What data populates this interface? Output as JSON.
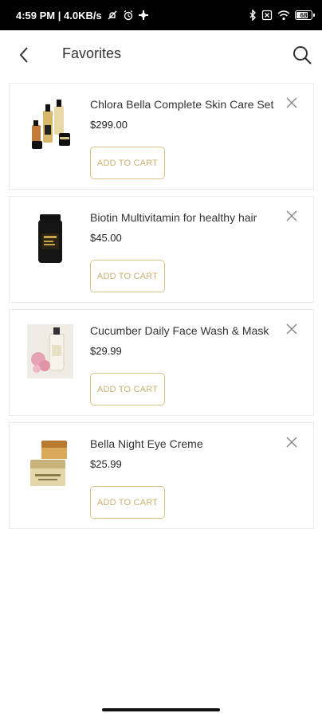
{
  "status_bar": {
    "time_speed": "4:59 PM | 4.0KB/s",
    "battery_level": "68"
  },
  "header": {
    "title": "Favorites",
    "back_icon": "chevron-left-icon",
    "search_icon": "search-icon"
  },
  "colors": {
    "accent_gold": "#c9b172",
    "border": "#ececec"
  },
  "favorites": [
    {
      "name": "Chlora Bella Complete Skin Care Set",
      "price": "$299.00",
      "add_label": "ADD TO CART",
      "image": "skincare-set-bottles"
    },
    {
      "name": "Biotin Multivitamin for healthy hair",
      "price": "$45.00",
      "add_label": "ADD TO CART",
      "image": "vitamin-bottle"
    },
    {
      "name": "Cucumber Daily Face Wash & Mask",
      "price": "$29.99",
      "add_label": "ADD TO CART",
      "image": "face-wash-bottle"
    },
    {
      "name": "Bella Night Eye Creme",
      "price": "$25.99",
      "add_label": "ADD TO CART",
      "image": "eye-creme-jars"
    }
  ]
}
